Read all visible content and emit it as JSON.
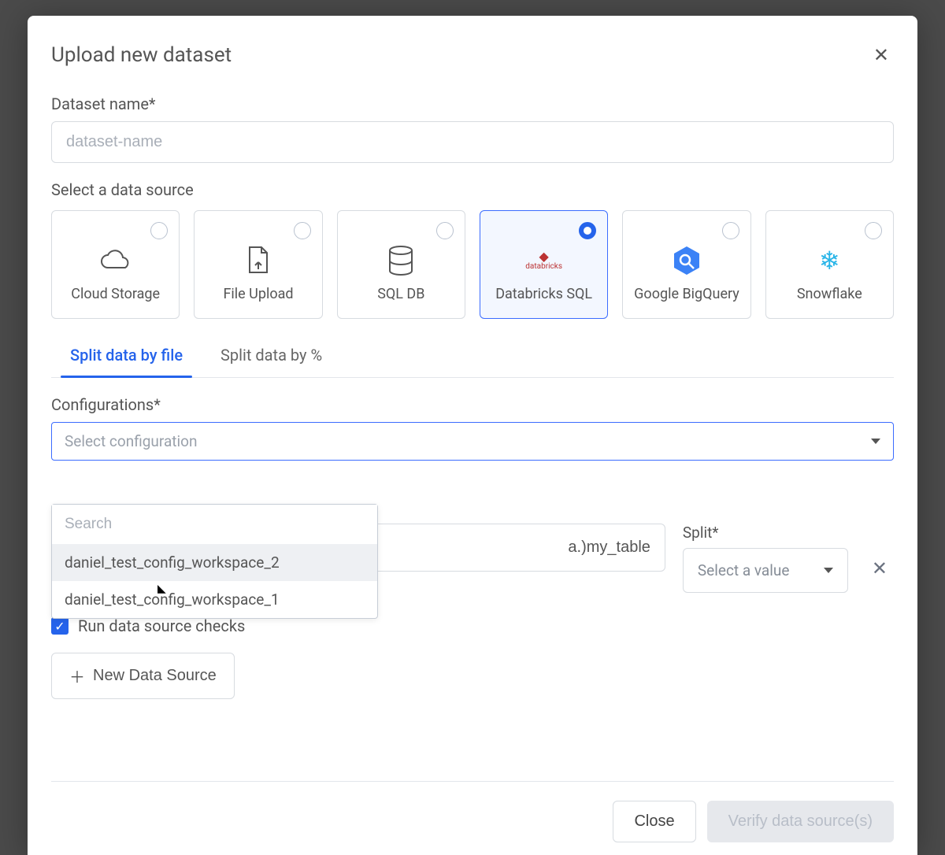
{
  "modal": {
    "title": "Upload new dataset",
    "close_icon": "close"
  },
  "dataset_name": {
    "label": "Dataset name*",
    "placeholder": "dataset-name",
    "value": ""
  },
  "source_section": {
    "label": "Select a data source",
    "items": [
      {
        "id": "cloud-storage",
        "label": "Cloud Storage",
        "selected": false,
        "icon": "cloud"
      },
      {
        "id": "file-upload",
        "label": "File Upload",
        "selected": false,
        "icon": "file-up"
      },
      {
        "id": "sql-db",
        "label": "SQL DB",
        "selected": false,
        "icon": "database"
      },
      {
        "id": "databricks-sql",
        "label": "Databricks SQL",
        "selected": true,
        "icon": "databricks"
      },
      {
        "id": "bigquery",
        "label": "Google BigQuery",
        "selected": false,
        "icon": "bigquery"
      },
      {
        "id": "snowflake",
        "label": "Snowflake",
        "selected": false,
        "icon": "snowflake"
      }
    ]
  },
  "tabs": [
    {
      "id": "split-file",
      "label": "Split data by file",
      "active": true
    },
    {
      "id": "split-percent",
      "label": "Split data by %",
      "active": false
    }
  ],
  "config": {
    "label": "Configurations*",
    "placeholder": "Select configuration",
    "search_placeholder": "Search",
    "options": [
      {
        "label": "daniel_test_config_workspace_2",
        "hovered": true
      },
      {
        "label": "daniel_test_config_workspace_1",
        "hovered": false
      }
    ]
  },
  "table_row": {
    "table_visible_text": "a.)my_table",
    "split": {
      "label": "Split*",
      "placeholder": "Select a value"
    }
  },
  "checks": {
    "label": "Run data source checks",
    "checked": true
  },
  "new_source_button": "New Data Source",
  "footer": {
    "close": "Close",
    "verify": "Verify data source(s)"
  },
  "colors": {
    "accent": "#2563eb"
  }
}
